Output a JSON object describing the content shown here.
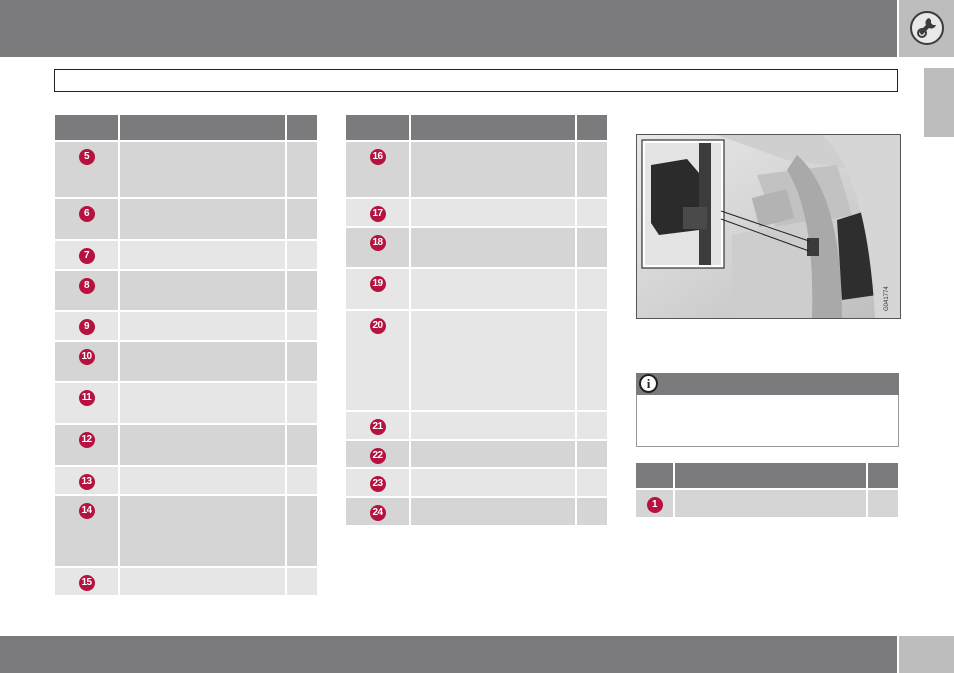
{
  "header": {
    "title": "",
    "section_icon": "wrench-gear-icon"
  },
  "table_left": {
    "columns": [
      "",
      "",
      ""
    ],
    "rows": [
      {
        "num": "5"
      },
      {
        "num": "6"
      },
      {
        "num": "7"
      },
      {
        "num": "8"
      },
      {
        "num": "9"
      },
      {
        "num": "10"
      },
      {
        "num": "11"
      },
      {
        "num": "12"
      },
      {
        "num": "13"
      },
      {
        "num": "14"
      },
      {
        "num": "15"
      }
    ]
  },
  "table_mid": {
    "columns": [
      "",
      "",
      ""
    ],
    "rows": [
      {
        "num": "16"
      },
      {
        "num": "17"
      },
      {
        "num": "18"
      },
      {
        "num": "19"
      },
      {
        "num": "20"
      },
      {
        "num": "21"
      },
      {
        "num": "22"
      },
      {
        "num": "23"
      },
      {
        "num": "24"
      }
    ]
  },
  "image": {
    "code": "G041774",
    "icon": "glovebox-fuse-box-illustration"
  },
  "note": {
    "icon": "info-icon",
    "symbol": "i",
    "text": ""
  },
  "table_right": {
    "columns": [
      "",
      "",
      ""
    ],
    "rows": [
      {
        "num": "1"
      }
    ]
  },
  "footer": {
    "page_number": ""
  },
  "colors": {
    "bar": "#7b7b7d",
    "badge": "#b5123f",
    "row_odd": "#d5d5d6",
    "row_even": "#e6e6e7"
  }
}
